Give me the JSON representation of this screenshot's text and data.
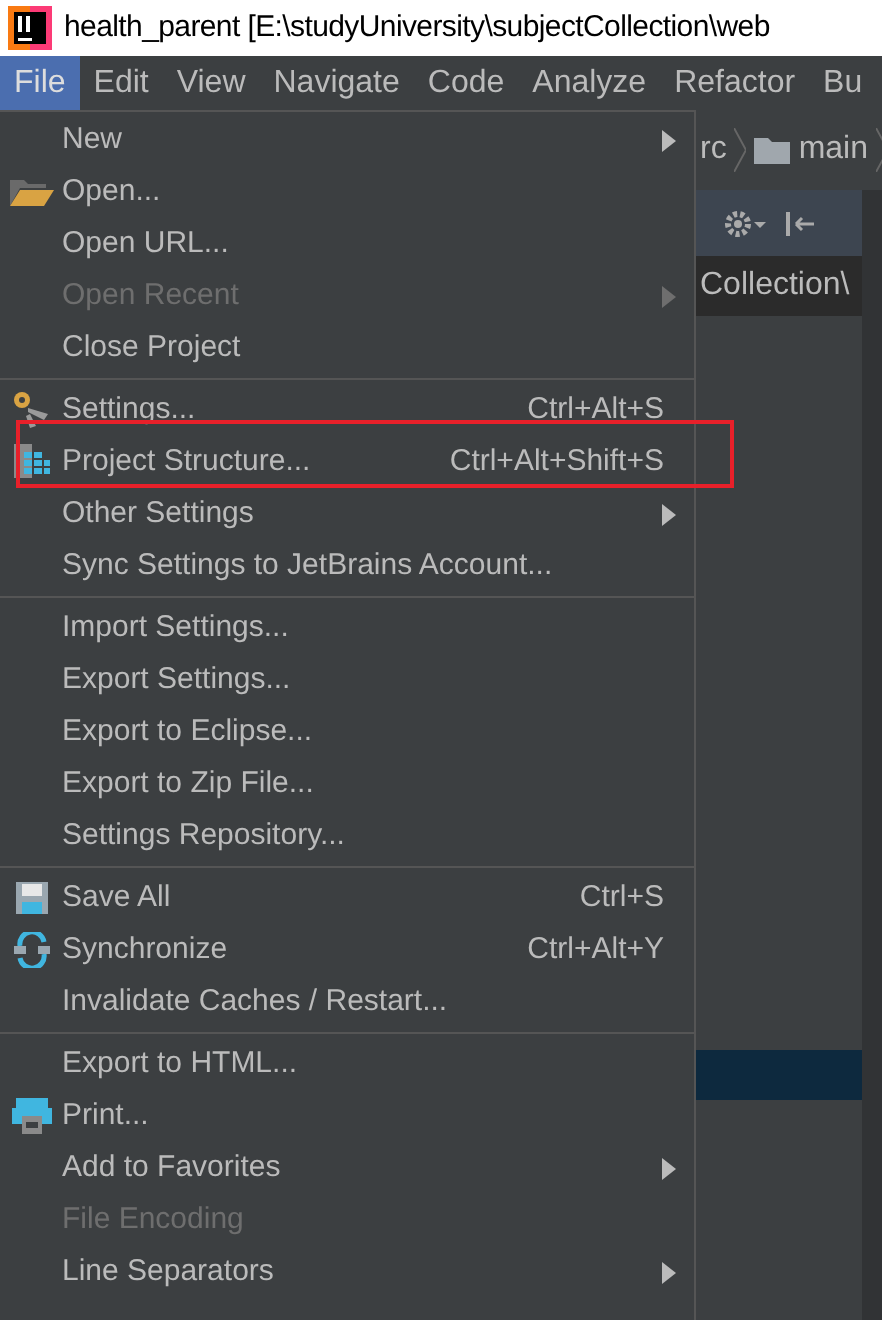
{
  "window": {
    "title": "health_parent [E:\\studyUniversity\\subjectCollection\\web"
  },
  "menu_bar": [
    {
      "label": "File",
      "selected": true
    },
    {
      "label": "Edit",
      "selected": false
    },
    {
      "label": "View",
      "selected": false
    },
    {
      "label": "Navigate",
      "selected": false
    },
    {
      "label": "Code",
      "selected": false
    },
    {
      "label": "Analyze",
      "selected": false
    },
    {
      "label": "Refactor",
      "selected": false
    },
    {
      "label": "Bu",
      "selected": false
    }
  ],
  "background": {
    "breadcrumb": [
      "rc",
      "main"
    ],
    "path_text": "Collection\\"
  },
  "file_menu": {
    "groups": [
      [
        {
          "label": "New",
          "submenu": true,
          "disabled": false
        },
        {
          "label": "Open...",
          "submenu": false,
          "disabled": false
        },
        {
          "label": "Open URL...",
          "submenu": false,
          "disabled": false
        },
        {
          "label": "Open Recent",
          "submenu": true,
          "disabled": true
        },
        {
          "label": "Close Project",
          "submenu": false,
          "disabled": false
        }
      ],
      [
        {
          "label": "Settings...",
          "shortcut": "Ctrl+Alt+S",
          "submenu": false,
          "disabled": false
        },
        {
          "label": "Project Structure...",
          "shortcut": "Ctrl+Alt+Shift+S",
          "submenu": false,
          "disabled": false,
          "highlighted": true
        },
        {
          "label": "Other Settings",
          "submenu": true,
          "disabled": false
        },
        {
          "label": "Sync Settings to JetBrains Account...",
          "submenu": false,
          "disabled": false
        }
      ],
      [
        {
          "label": "Import Settings...",
          "submenu": false,
          "disabled": false
        },
        {
          "label": "Export Settings...",
          "submenu": false,
          "disabled": false
        },
        {
          "label": "Export to Eclipse...",
          "submenu": false,
          "disabled": false
        },
        {
          "label": "Export to Zip File...",
          "submenu": false,
          "disabled": false
        },
        {
          "label": "Settings Repository...",
          "submenu": false,
          "disabled": false
        }
      ],
      [
        {
          "label": "Save All",
          "shortcut": "Ctrl+S",
          "submenu": false,
          "disabled": false
        },
        {
          "label": "Synchronize",
          "shortcut": "Ctrl+Alt+Y",
          "submenu": false,
          "disabled": false
        },
        {
          "label": "Invalidate Caches / Restart...",
          "submenu": false,
          "disabled": false
        }
      ],
      [
        {
          "label": "Export to HTML...",
          "submenu": false,
          "disabled": false
        },
        {
          "label": "Print...",
          "submenu": false,
          "disabled": false
        },
        {
          "label": "Add to Favorites",
          "submenu": true,
          "disabled": false
        },
        {
          "label": "File Encoding",
          "submenu": false,
          "disabled": true
        },
        {
          "label": "Line Separators",
          "submenu": true,
          "disabled": false
        }
      ]
    ]
  }
}
